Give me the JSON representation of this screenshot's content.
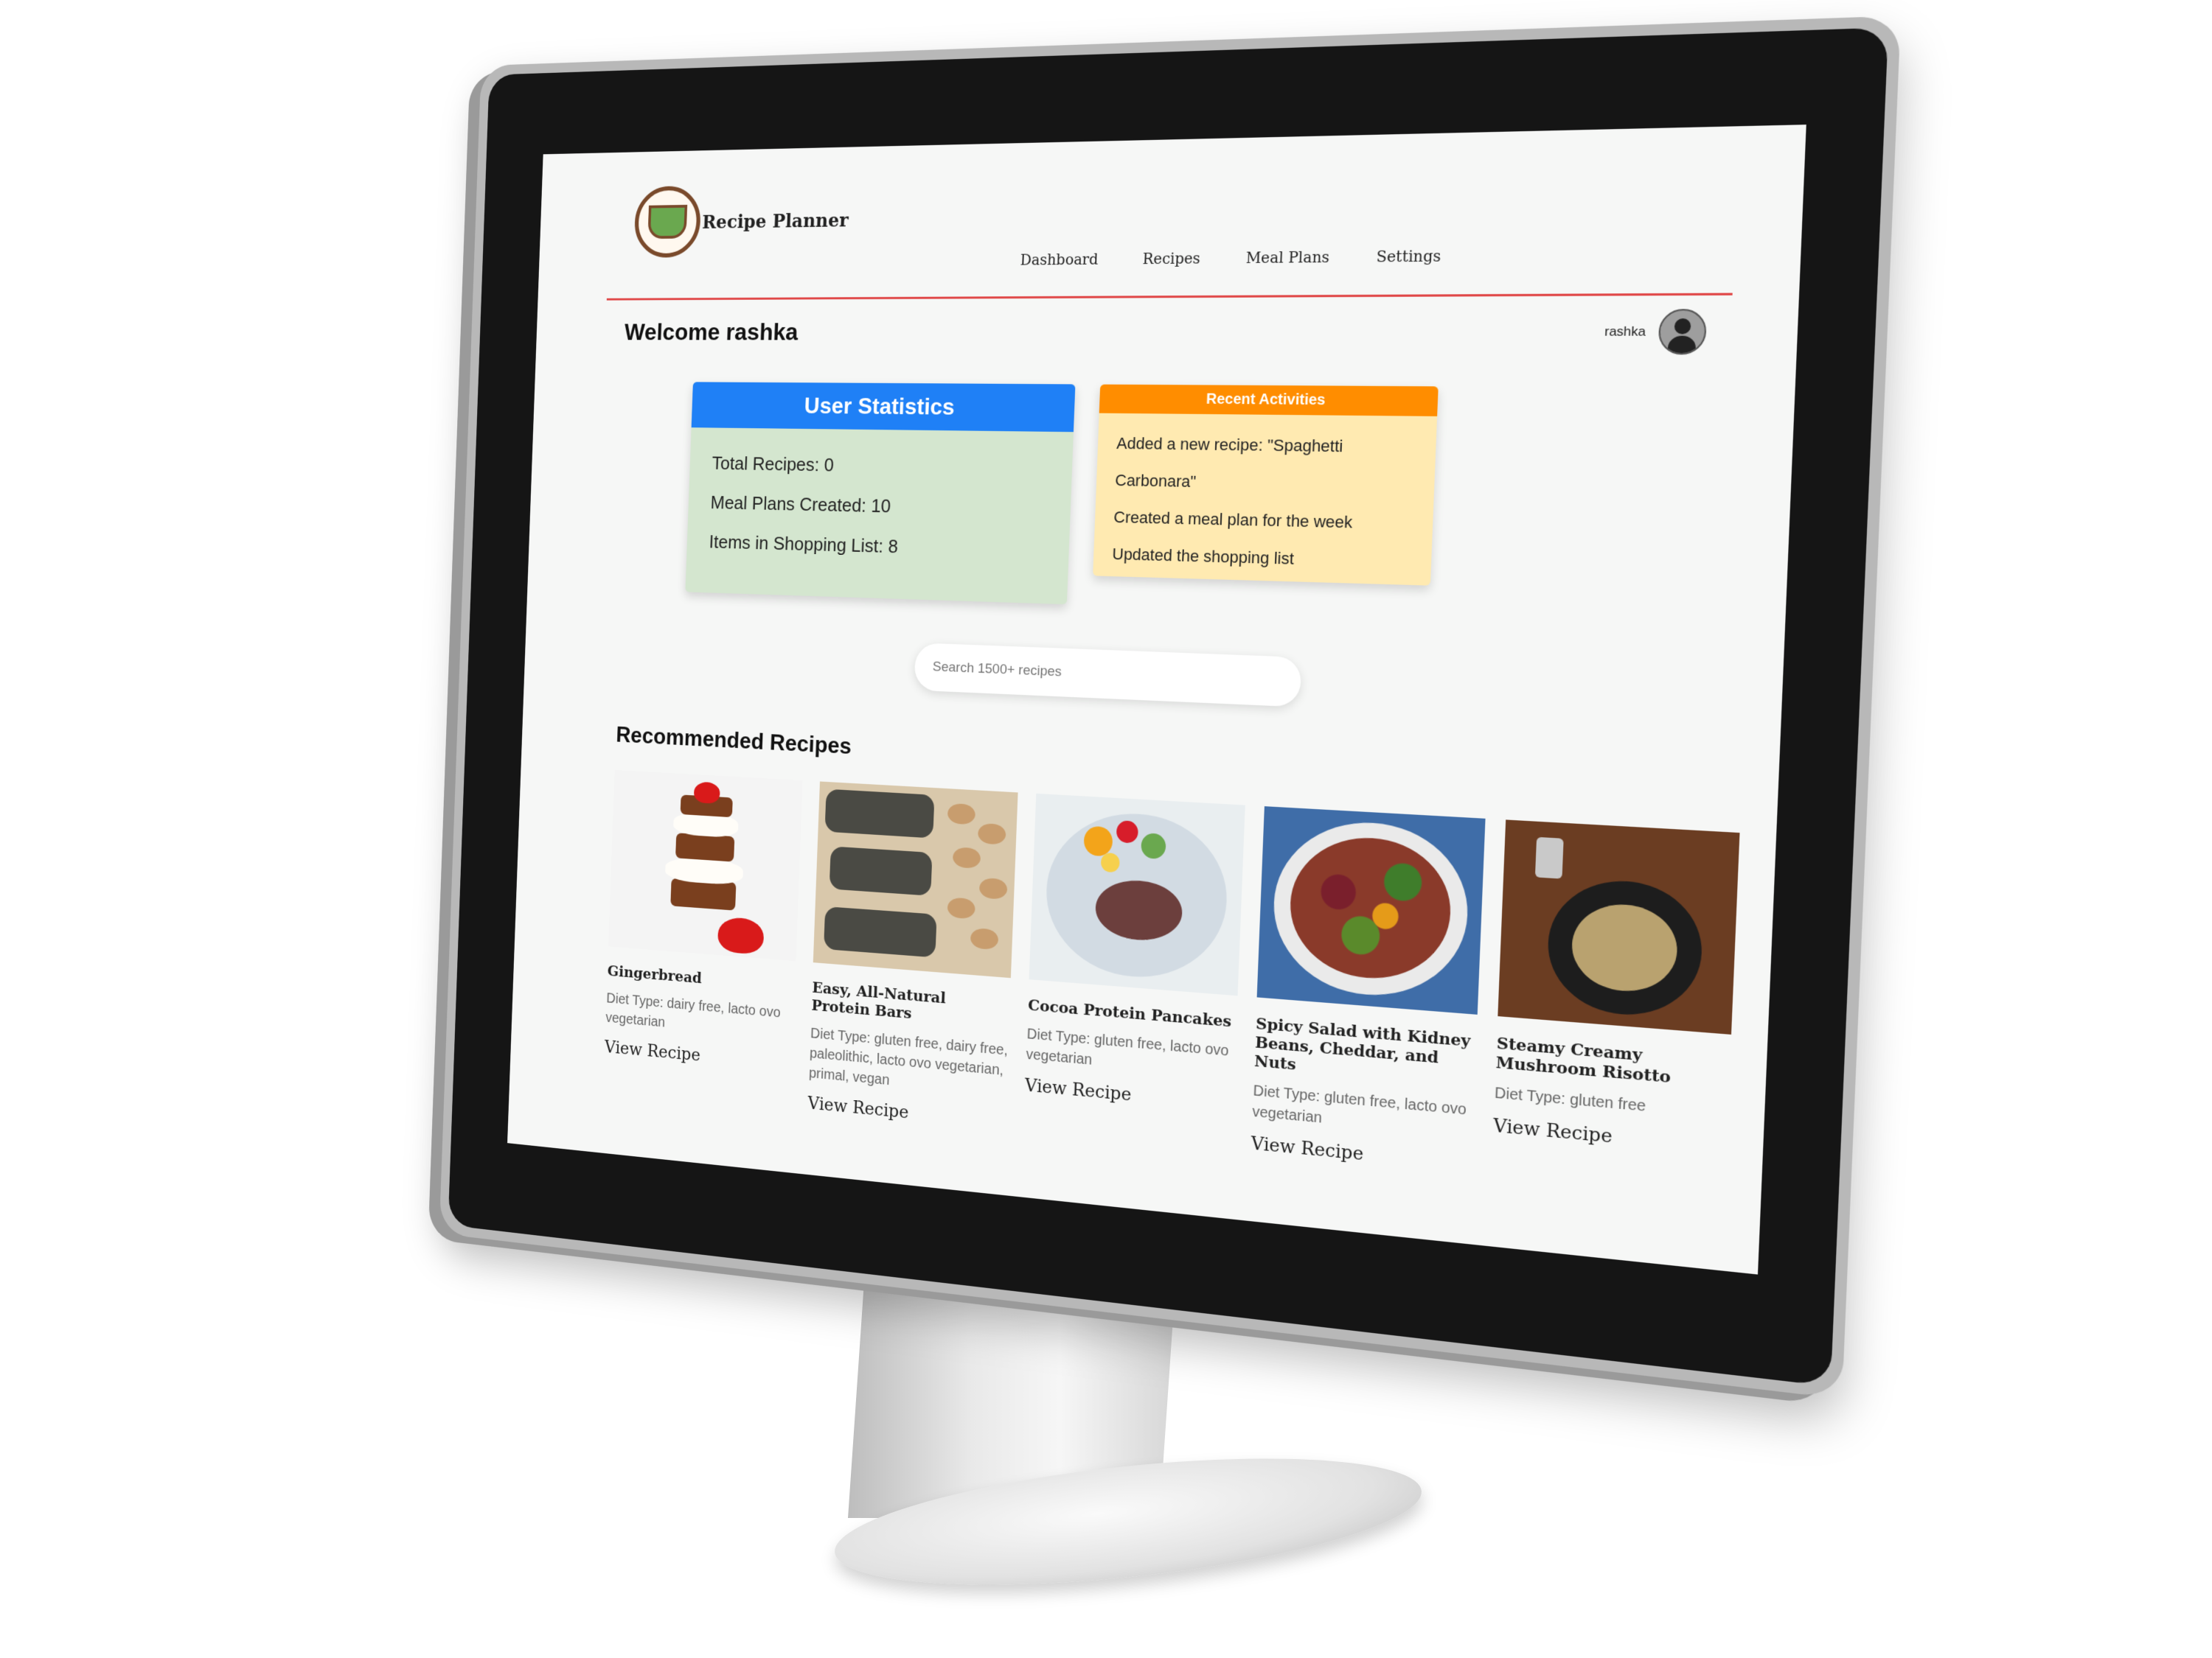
{
  "app": {
    "brand": "Recipe Planner",
    "nav": [
      "Dashboard",
      "Recipes",
      "Meal Plans",
      "Settings"
    ]
  },
  "user": {
    "welcome": "Welcome rashka",
    "name": "rashka"
  },
  "stats": {
    "title": "User Statistics",
    "lines": [
      "Total Recipes: 0",
      "Meal Plans Created: 10",
      "Items in Shopping List: 8"
    ]
  },
  "activities": {
    "title": "Recent Activities",
    "items": [
      "Added a new recipe: \"Spaghetti Carbonara\"",
      "Created a meal plan for the week",
      "Updated the shopping list"
    ]
  },
  "search": {
    "placeholder": "Search 1500+ recipes"
  },
  "recommended": {
    "title": "Recommended Recipes",
    "view_label": "View Recipe",
    "recipes": [
      {
        "name": "Gingerbread",
        "diet": "Diet Type: dairy free, lacto ovo vegetarian"
      },
      {
        "name": "Easy, All-Natural Protein Bars",
        "diet": "Diet Type: gluten free, dairy free, paleolithic, lacto ovo vegetarian, primal, vegan"
      },
      {
        "name": "Cocoa Protein Pancakes",
        "diet": "Diet Type: gluten free, lacto ovo vegetarian"
      },
      {
        "name": "Spicy Salad with Kidney Beans, Cheddar, and Nuts",
        "diet": "Diet Type: gluten free, lacto ovo vegetarian"
      },
      {
        "name": "Steamy Creamy Mushroom Risotto",
        "diet": "Diet Type: gluten free"
      }
    ]
  },
  "colors": {
    "stats_header": "#1f80f6",
    "stats_body": "#d4e6cf",
    "activities_header": "#ff8d00",
    "activities_body": "#ffeab1",
    "header_rule": "#e04848"
  }
}
